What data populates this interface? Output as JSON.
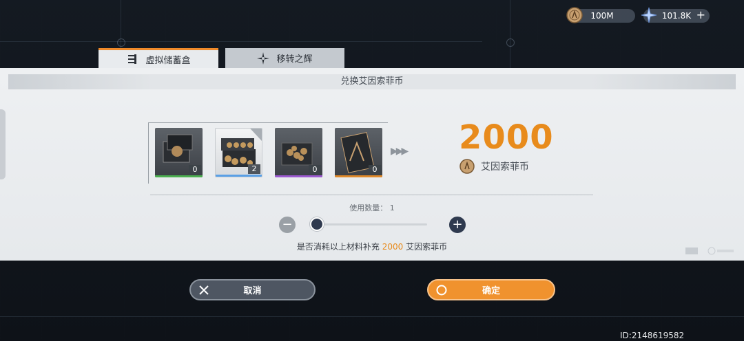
{
  "currencies": [
    {
      "name": "coin",
      "value": "100M",
      "icon": "coin-icon"
    },
    {
      "name": "crystal",
      "value": "101.8K",
      "icon": "crystal-icon",
      "add": "+"
    }
  ],
  "tabs": [
    {
      "label": "虚拟储蓄盒",
      "icon": "list-icon",
      "active": true
    },
    {
      "label": "移转之辉",
      "icon": "star-icon",
      "active": false
    }
  ],
  "panel": {
    "title": "兑换艾因索菲币",
    "items": [
      {
        "count": "0",
        "rarity_color": "#4caf50"
      },
      {
        "count": "2",
        "rarity_color": "#5aa0e6",
        "selected": true
      },
      {
        "count": "0",
        "rarity_color": "#9c5ad0"
      },
      {
        "count": "0",
        "rarity_color": "#e08a2a"
      }
    ],
    "result_amount": "2000",
    "result_currency": "艾因索菲币",
    "quantity_label": "使用数量： 1",
    "quantity": 1,
    "confirm_prefix": "是否消耗以上材料补充 ",
    "confirm_amount": "2000",
    "confirm_suffix": " 艾因索菲币"
  },
  "buttons": {
    "cancel": "取消",
    "ok": "确定"
  },
  "uid": "ID:2148619582",
  "colors": {
    "accent": "#e88b1c",
    "confirm": "#f0922e"
  }
}
